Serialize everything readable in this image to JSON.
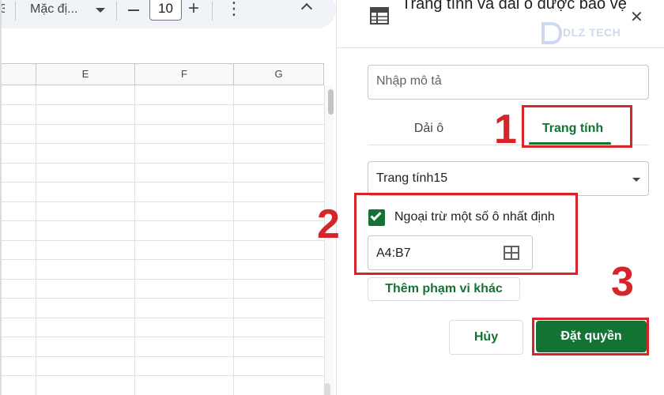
{
  "toolbar": {
    "cut_glyph": "3",
    "font_name": "Mặc đị...",
    "font_size": "10",
    "plus": "+",
    "more": "⋮"
  },
  "sheet": {
    "columns": [
      "",
      "E",
      "F",
      "G"
    ]
  },
  "panel": {
    "title": "Trang tính và dải ô được bảo vệ",
    "close": "✕",
    "watermark": "DLZ TECH",
    "description_placeholder": "Nhập mô tả",
    "tabs": [
      {
        "label": "Dải ô",
        "selected": false
      },
      {
        "label": "Trang tính",
        "selected": true
      }
    ],
    "sheet_select_value": "Trang tính15",
    "except_checkbox": {
      "checked": true,
      "label": "Ngoại trừ một số ô nhất định"
    },
    "range_value": "A4:B7",
    "add_range_label": "Thêm phạm vi khác",
    "cancel_label": "Hủy",
    "confirm_label": "Đặt quyền"
  },
  "callouts": [
    "1",
    "2",
    "3"
  ],
  "colors": {
    "accent": "#137333",
    "callout": "#d7232a"
  }
}
